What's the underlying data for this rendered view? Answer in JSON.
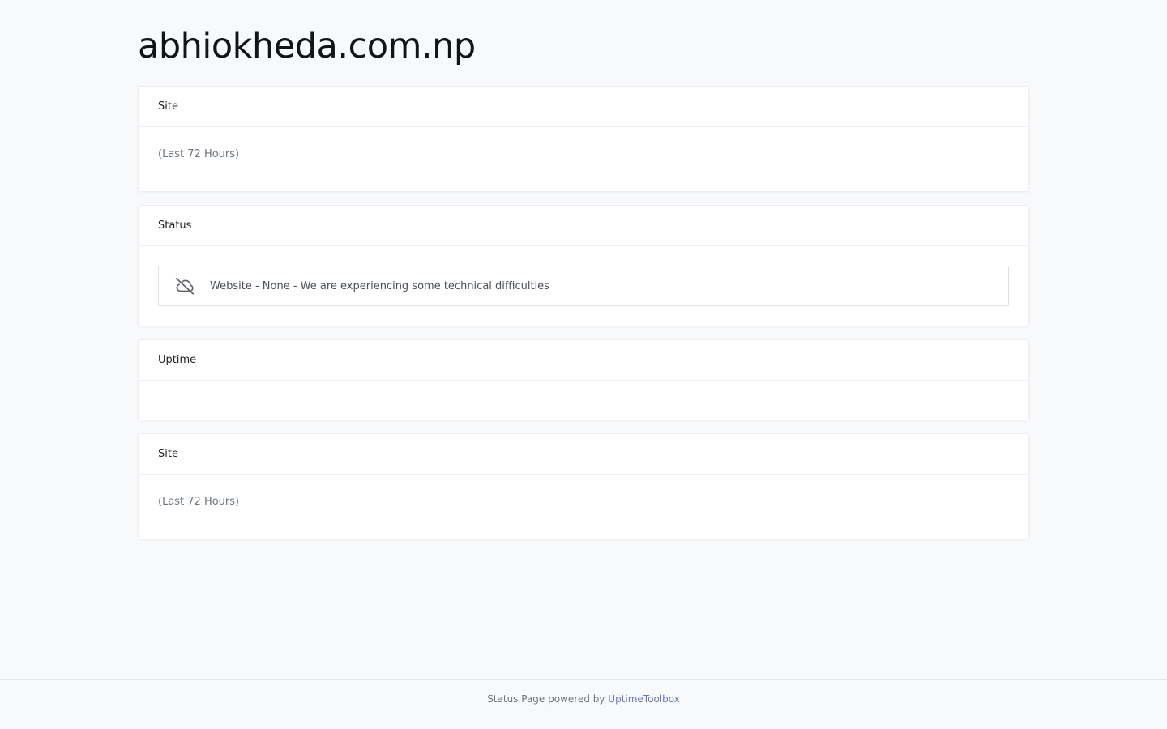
{
  "header": {
    "title": "abhiokheda.com.np"
  },
  "cards": {
    "site_top": {
      "title": "Site",
      "subtitle": "(Last 72 Hours)"
    },
    "status": {
      "title": "Status",
      "icon": "cloud-off-icon",
      "message": "Website - None - We are experiencing some technical difficulties"
    },
    "uptime": {
      "title": "Uptime"
    },
    "site_bottom": {
      "title": "Site",
      "subtitle": "(Last 72 Hours)"
    }
  },
  "footer": {
    "text": "Status Page powered by",
    "link_label": "UptimeToolbox"
  },
  "colors": {
    "background": "#f8f9fb",
    "link": "#6674cc"
  }
}
